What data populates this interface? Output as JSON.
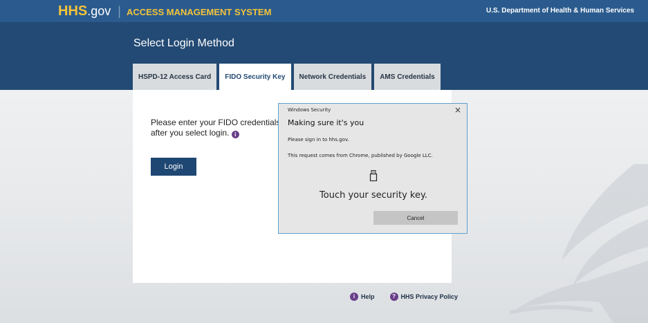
{
  "header": {
    "brand_hhs": "HHS",
    "brand_gov": ".gov",
    "brand_separator": "|",
    "system_name": "ACCESS MANAGEMENT SYSTEM",
    "department": "U.S. Department of Health & Human Services"
  },
  "page": {
    "title": "Select Login Method"
  },
  "tabs": [
    {
      "label": "HSPD-12 Access Card",
      "active": false
    },
    {
      "label": "FIDO Security Key",
      "active": true
    },
    {
      "label": "Network Credentials",
      "active": false
    },
    {
      "label": "AMS Credentials",
      "active": false
    }
  ],
  "card": {
    "instructions": "Please enter your FIDO credentials after you select login.",
    "info_icon": "info-icon",
    "login_label": "Login"
  },
  "dialog": {
    "header": "Windows Security",
    "close_glyph": "×",
    "title": "Making sure it's you",
    "line1": "Please sign in to hhs.gov.",
    "line2": "This request comes from Chrome, published by Google LLC.",
    "icon": "usb-security-key-icon",
    "touch_text": "Touch your security key.",
    "cancel_label": "Cancel"
  },
  "footer": {
    "help_label": "Help",
    "privacy_label": "HHS Privacy Policy",
    "info_glyph": "i",
    "question_glyph": "?"
  },
  "colors": {
    "topbar": "#2b5b8e",
    "header_band": "#234a74",
    "brand_accent": "#f3c43a",
    "login_button": "#1e4773",
    "icon_purple": "#6a3f8a",
    "dialog_border": "#5d9fd0"
  }
}
